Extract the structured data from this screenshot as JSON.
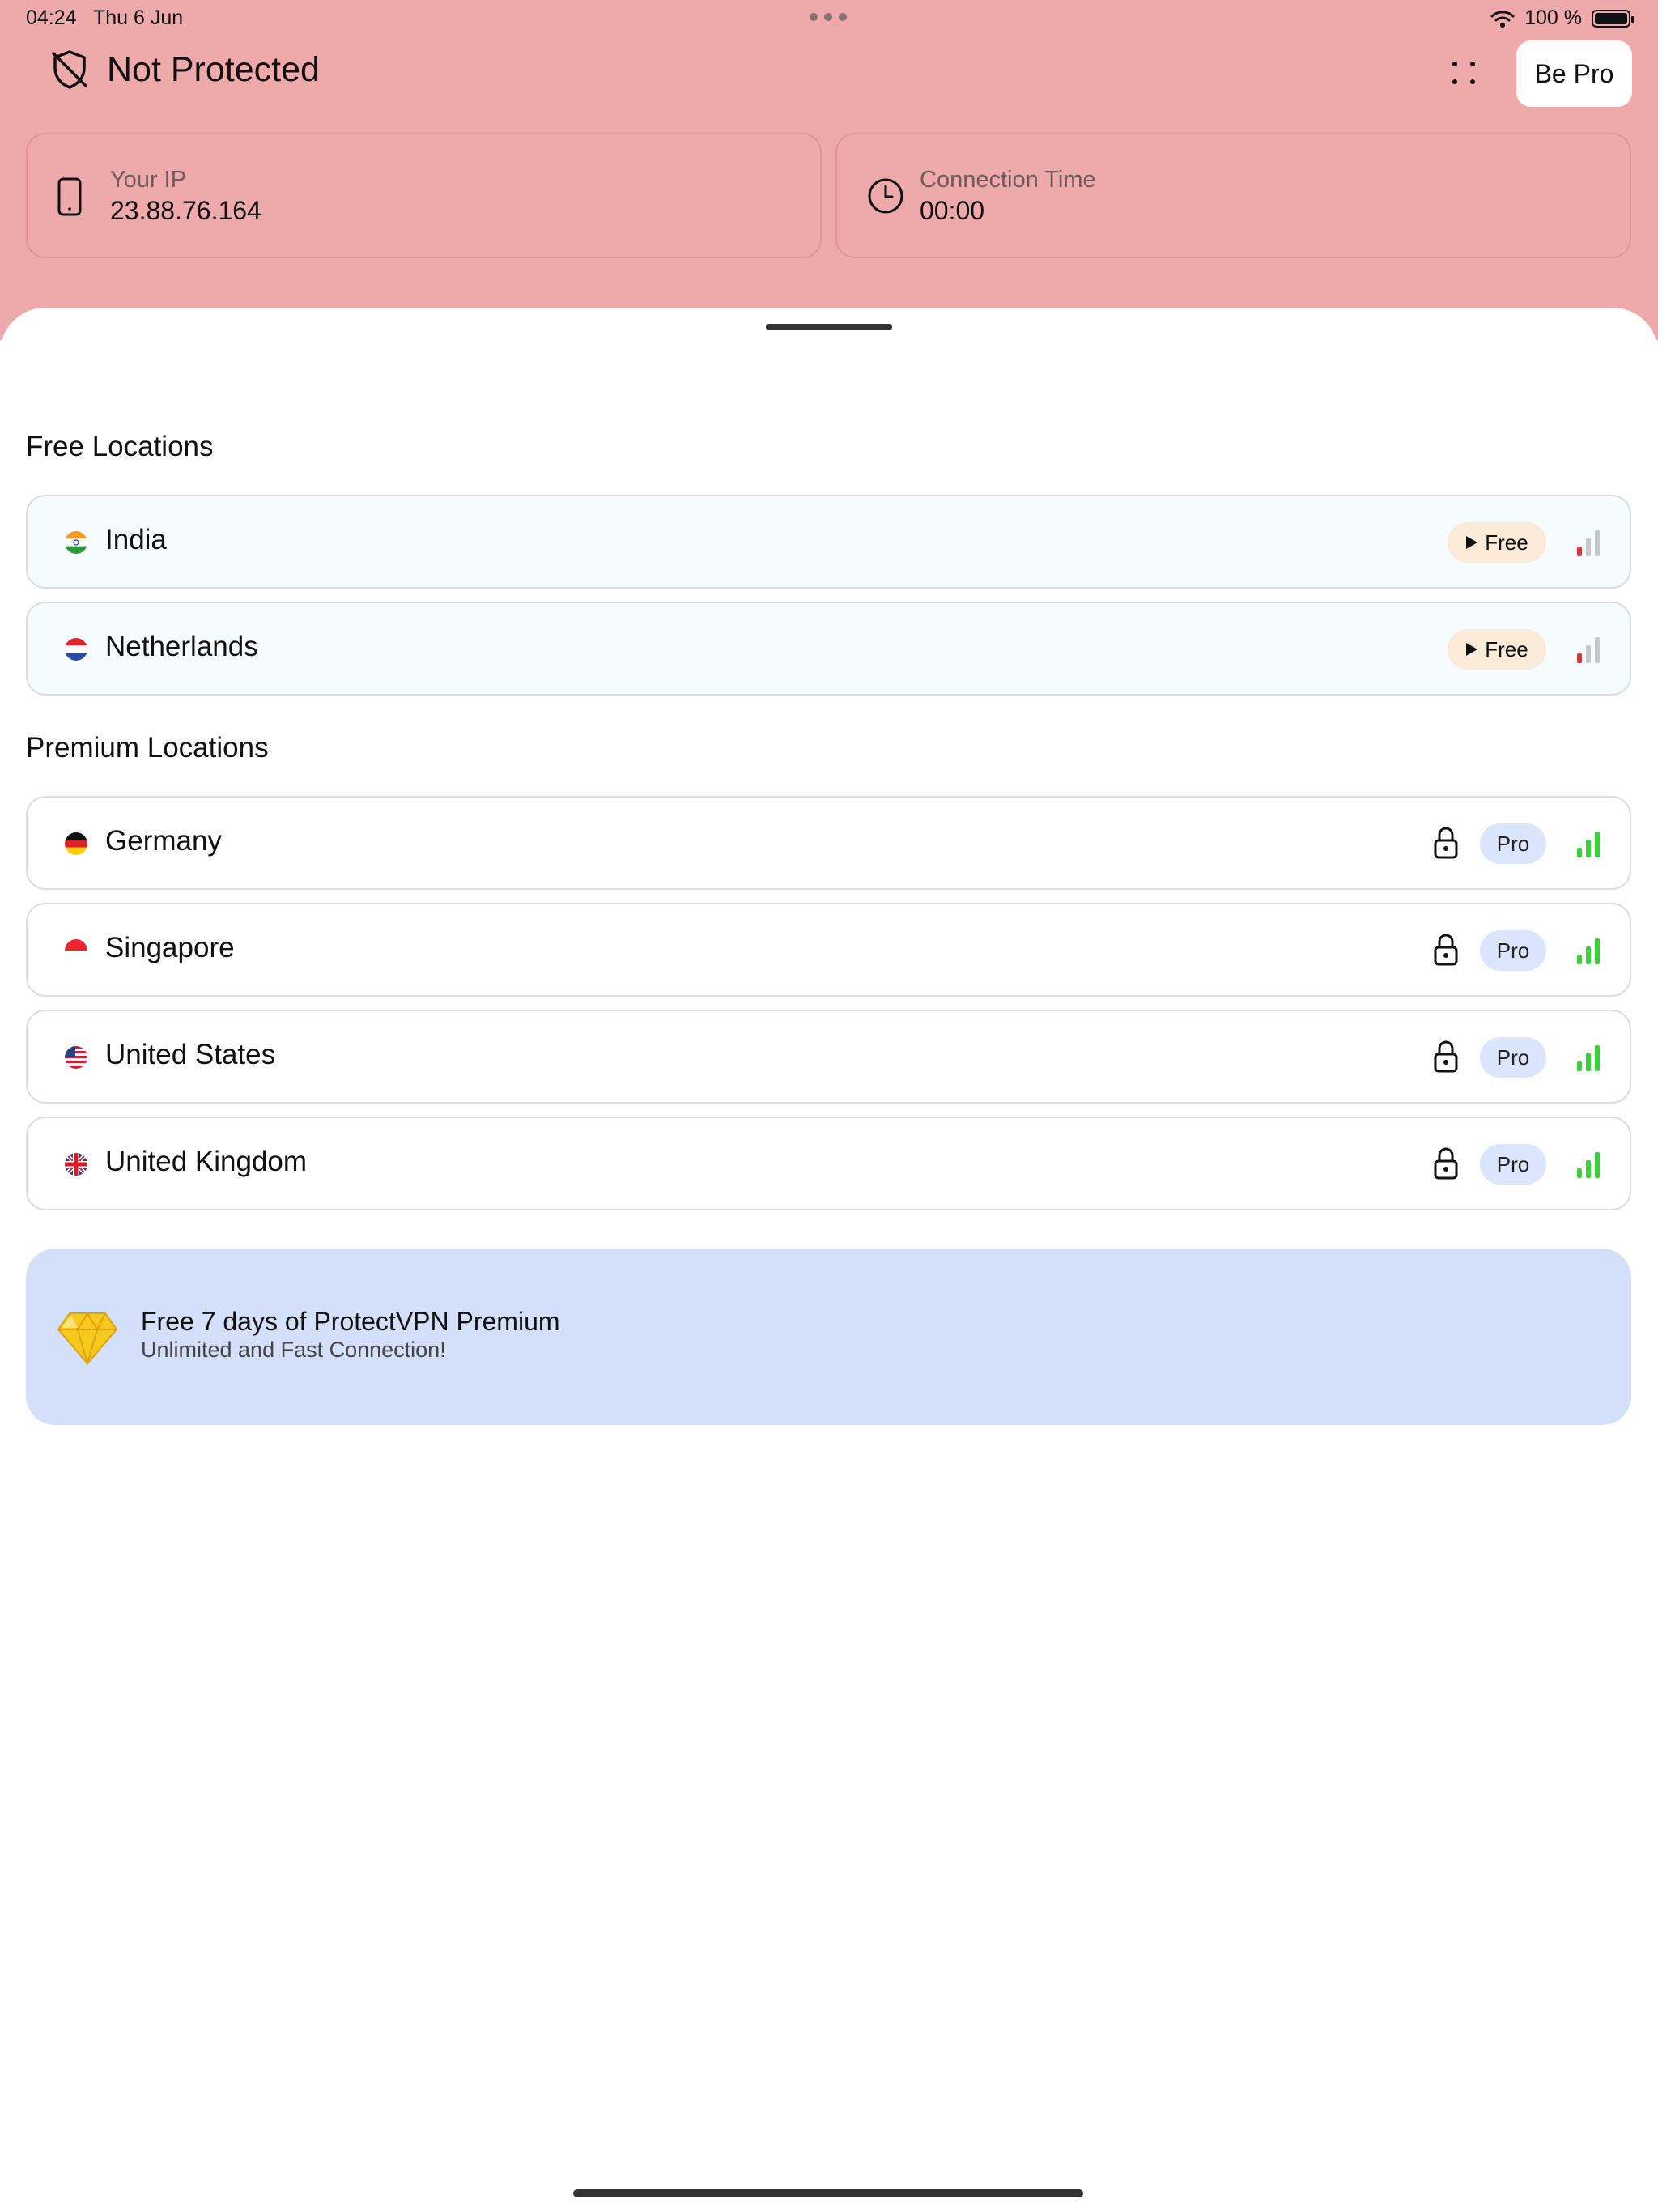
{
  "status_bar": {
    "time": "04:24",
    "date": "Thu 6 Jun",
    "battery": "100 %"
  },
  "header": {
    "status_title": "Not Protected",
    "be_pro_label": "Be Pro",
    "background_color": "#eeaaab",
    "ip_card": {
      "label": "Your IP",
      "value": "23.88.76.164"
    },
    "time_card": {
      "label": "Connection Time",
      "value": "00:00"
    }
  },
  "free_section": {
    "title": "Free Locations",
    "items": [
      {
        "name": "India",
        "badge": "Free",
        "flag": "india-flag-icon",
        "signal": 1
      },
      {
        "name": "Netherlands",
        "badge": "Free",
        "flag": "netherlands-flag-icon",
        "signal": 1
      }
    ]
  },
  "premium_section": {
    "title": "Premium Locations",
    "items": [
      {
        "name": "Germany",
        "badge": "Pro",
        "flag": "germany-flag-icon",
        "signal": 3
      },
      {
        "name": "Singapore",
        "badge": "Pro",
        "flag": "singapore-flag-icon",
        "signal": 3
      },
      {
        "name": "United States",
        "badge": "Pro",
        "flag": "united-states-flag-icon",
        "signal": 3
      },
      {
        "name": "United Kingdom",
        "badge": "Pro",
        "flag": "united-kingdom-flag-icon",
        "signal": 3
      }
    ]
  },
  "promo": {
    "title": "Free 7 days of ProtectVPN Premium",
    "subtitle": "Unlimited and Fast Connection!",
    "icon": "diamond-icon",
    "background_color": "#d4e0fa"
  },
  "colors": {
    "signal_good": "#3ccf3c",
    "signal_weak": "#d43a3a",
    "signal_off": "#c7c7c7"
  }
}
